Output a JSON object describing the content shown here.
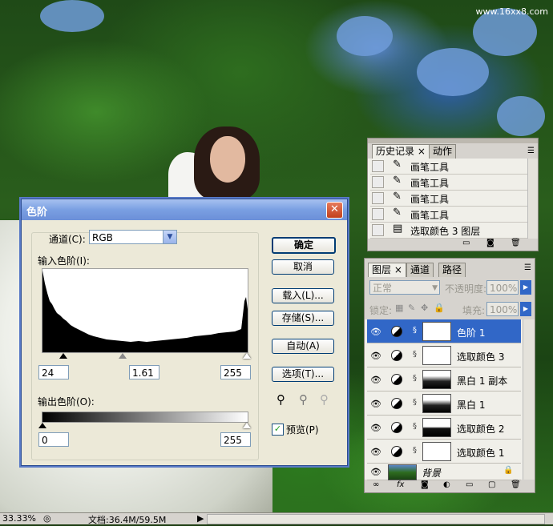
{
  "watermark": "www.16xx8.com",
  "levels_dialog": {
    "title": "色阶",
    "close_glyph": "✕",
    "channel_label": "通道(C):",
    "channel_value": "RGB",
    "input_label": "输入色阶(I):",
    "input_black": "24",
    "input_gamma": "1.61",
    "input_white": "255",
    "output_label": "输出色阶(O):",
    "output_black": "0",
    "output_white": "255",
    "buttons": {
      "ok": "确定",
      "cancel": "取消",
      "load": "载入(L)...",
      "save": "存储(S)...",
      "auto": "自动(A)",
      "options": "选项(T)..."
    },
    "preview_label": "预览(P)",
    "preview_checked": true
  },
  "history_panel": {
    "tabs": [
      "历史记录",
      "动作"
    ],
    "tab_close": "×",
    "items": [
      "画笔工具",
      "画笔工具",
      "画笔工具",
      "画笔工具",
      "选取颜色 3 图层"
    ]
  },
  "layers_panel": {
    "tabs": [
      "图层",
      "通道",
      "路径"
    ],
    "tab_close": "×",
    "blend_mode": "正常",
    "opacity_label": "不透明度:",
    "opacity_value": "100%",
    "lock_label": "锁定:",
    "fill_label": "填充:",
    "fill_value": "100%",
    "layers": [
      {
        "name": "色阶 1",
        "selected": true
      },
      {
        "name": "选取颜色 3",
        "selected": false
      },
      {
        "name": "黑白 1 副本",
        "selected": false
      },
      {
        "name": "黑白 1",
        "selected": false
      },
      {
        "name": "选取颜色 2",
        "selected": false
      },
      {
        "name": "选取颜色 1",
        "selected": false
      },
      {
        "name": "背景",
        "selected": false
      }
    ]
  },
  "status_bar": {
    "zoom": "33.33%",
    "doc_info": "文档:36.4M/59.5M"
  }
}
